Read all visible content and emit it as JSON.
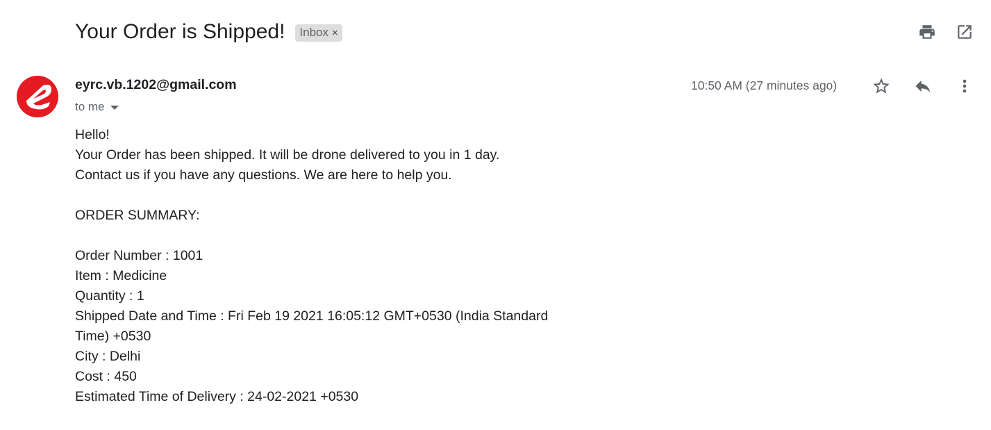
{
  "email": {
    "subject": "Your Order is Shipped!",
    "label": "Inbox",
    "label_remove": "×",
    "sender": "eyrc.vb.1202@gmail.com",
    "recipient": "to me",
    "timestamp": "10:50 AM (27 minutes ago)",
    "avatar_letter": "e",
    "avatar_color": "#e41b23"
  },
  "body": {
    "greeting": "Hello!",
    "line1": "Your Order has been shipped. It will be drone delivered to you in 1 day.",
    "line2": "Contact us if you have any questions. We are here to help you.",
    "summary_heading": "ORDER SUMMARY:",
    "order_number": "Order Number : 1001",
    "item": "Item : Medicine",
    "quantity": "Quantity : 1",
    "shipped": "Shipped Date and Time : Fri Feb 19 2021 16:05:12 GMT+0530 (India Standard Time) +0530",
    "city": "City : Delhi",
    "cost": "Cost : 450",
    "eta": "Estimated Time of Delivery : 24-02-2021 +0530"
  },
  "icons": {
    "print": "print-icon",
    "open_new_window": "open-in-new-window-icon",
    "star": "star-icon",
    "reply": "reply-icon",
    "more": "more-vertical-icon"
  }
}
